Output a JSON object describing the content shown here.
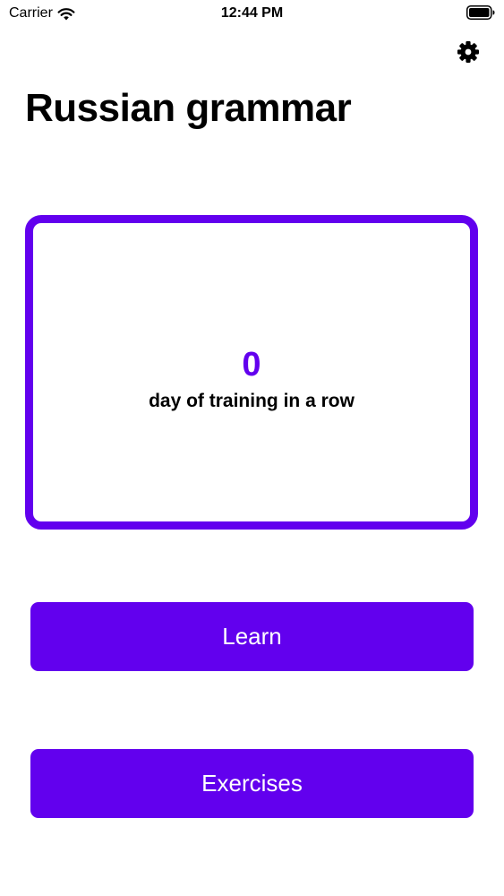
{
  "status_bar": {
    "carrier": "Carrier",
    "time": "12:44 PM",
    "wifi_icon": "wifi-icon",
    "battery_icon": "battery-icon"
  },
  "header": {
    "settings_icon": "gear-icon",
    "title": "Russian grammar"
  },
  "streak": {
    "count": "0",
    "label": "day of training in a row"
  },
  "actions": {
    "learn_label": "Learn",
    "exercises_label": "Exercises"
  },
  "colors": {
    "accent": "#6200ee",
    "background": "#ffffff",
    "button_text": "#ffffff"
  }
}
